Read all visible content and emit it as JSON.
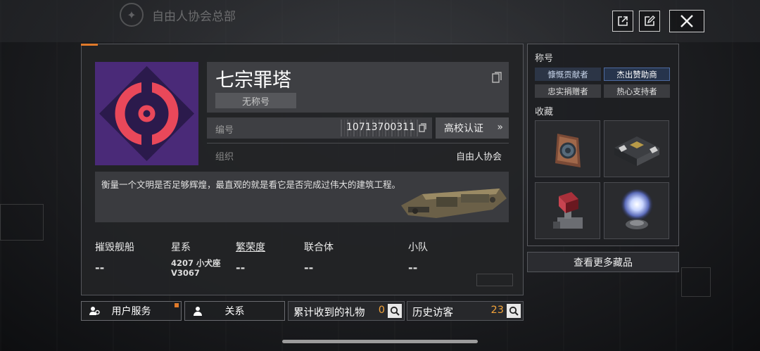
{
  "header": {
    "hq_title": "自由人协会总部"
  },
  "toolbar": {
    "share_icon": "external-link-icon",
    "edit_icon": "edit-icon",
    "close_icon": "close-icon"
  },
  "profile": {
    "name": "七宗罪塔",
    "title_badge": "无称号",
    "id_label": "编号",
    "id_value": "10713700311",
    "campus_button": "高校认证",
    "org_label": "组织",
    "org_value": "自由人协会",
    "signature": "衡量一个文明是否足够辉煌，最直观的就是看它是否完成过伟大的建筑工程。",
    "avatar_colors": {
      "bg": "#4a2a78",
      "diamond": "#2b1a4c",
      "ring": "#e9485a"
    }
  },
  "stats": [
    {
      "label": "摧毁舰船",
      "value": "--"
    },
    {
      "label": "星系",
      "value": "4207 小犬座 V3067"
    },
    {
      "label": "繁荣度",
      "value": "--"
    },
    {
      "label": "联合体",
      "value": "--"
    },
    {
      "label": "小队",
      "value": "--"
    }
  ],
  "right_panel": {
    "titles_heading": "称号",
    "titles": [
      "慷慨贡献者",
      "杰出赞助商",
      "忠实捐赠者",
      "热心支持者"
    ],
    "collection_heading": "收藏",
    "collection_items": [
      "gear-plaque-icon",
      "gold-chest-icon",
      "red-cube-device-icon",
      "glowing-orb-icon"
    ],
    "more_button": "查看更多藏品"
  },
  "bottom": {
    "user_service": "用户服务",
    "relations": "关系",
    "gifts_label": "累计收到的礼物",
    "gifts_count": "0",
    "visitors_label": "历史访客",
    "visitors_count": "23"
  },
  "colors": {
    "accent_orange": "#e07a2a",
    "count_orange": "#f2a33a",
    "selected_blue": "#4d6aa0"
  }
}
